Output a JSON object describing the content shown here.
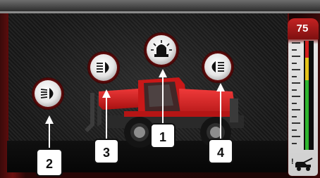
{
  "gauge": {
    "value": "75",
    "warning_mark": "!",
    "bottom_icon": "machine-stability-icon",
    "zones": {
      "red": "#d21d1d",
      "yellow": "#e4c21a",
      "green": "#2fb52f"
    }
  },
  "machine": {
    "icon": "telehandler-machine",
    "color": "#d41c1c"
  },
  "buttons": [
    {
      "id": "beacon",
      "icon": "rotating-beacon-icon"
    },
    {
      "id": "front-work-light",
      "icon": "work-light-icon"
    },
    {
      "id": "rear-work-light",
      "icon": "work-light-icon"
    },
    {
      "id": "side-work-light",
      "icon": "work-light-icon"
    }
  ],
  "callouts": [
    {
      "id": "callout-1",
      "label": "1"
    },
    {
      "id": "callout-2",
      "label": "2"
    },
    {
      "id": "callout-3",
      "label": "3"
    },
    {
      "id": "callout-4",
      "label": "4"
    }
  ]
}
